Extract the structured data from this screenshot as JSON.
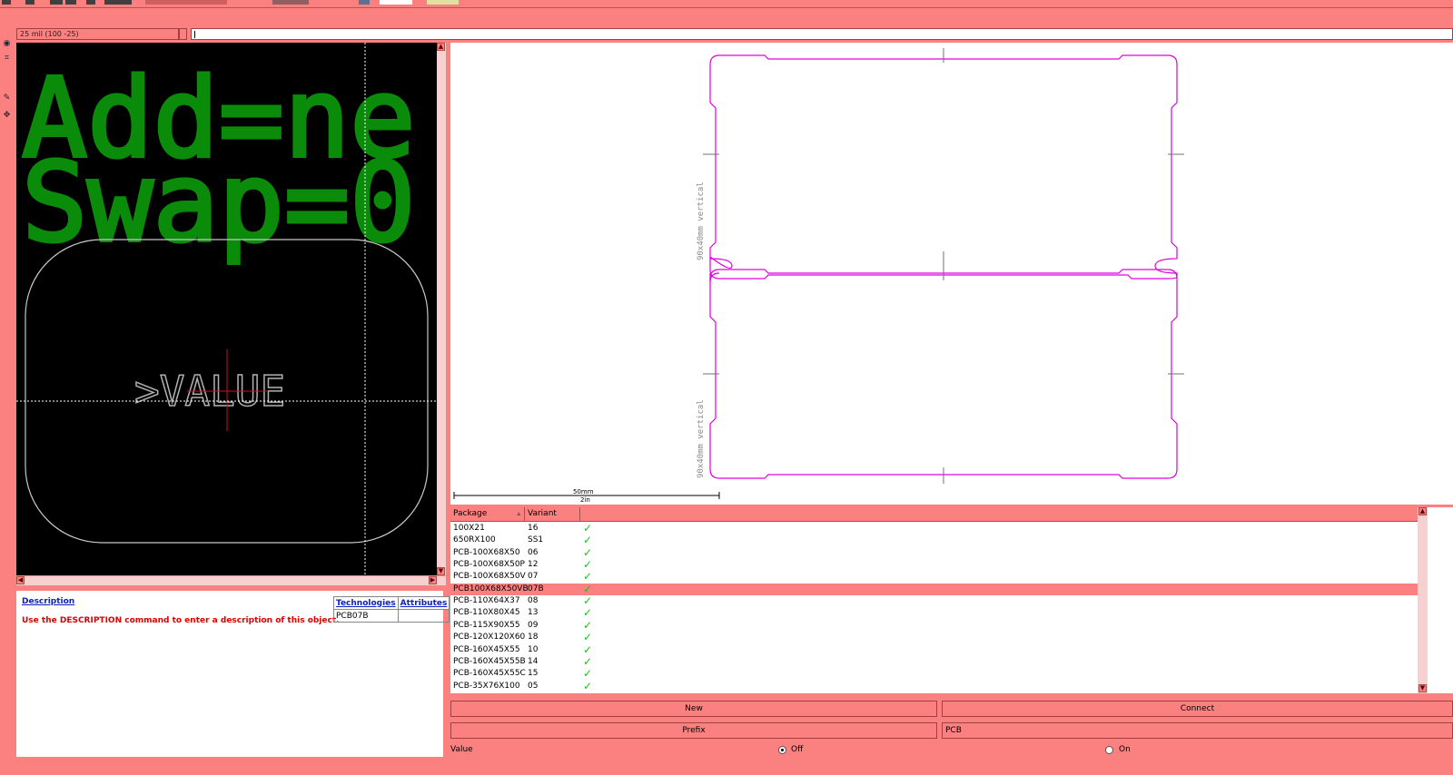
{
  "coordinate_readout": "25 mil (100 -25)",
  "editor": {
    "text_line1": "Add=ne",
    "text_line2": "Swap=0",
    "value_label": ">VALUE",
    "text_color": "#0a8c0a",
    "outline_color": "#c8c8c8"
  },
  "preview": {
    "side_label_top": "90x40mm vertical",
    "side_label_bottom": "90x40mm vertical",
    "scale_mm": "50mm",
    "scale_in": "2in",
    "outline_color": "#e000e0"
  },
  "description": {
    "link": "Description",
    "text": "Use the DESCRIPTION command to enter a description of this object.",
    "tech_header": "Technologies",
    "attr_header": "Attributes",
    "tech_value": "PCB07B",
    "attr_value": ""
  },
  "packages": {
    "col_package": "Package",
    "col_variant": "Variant",
    "check_icon": "check-icon",
    "rows": [
      {
        "package": "100X21",
        "variant": "16"
      },
      {
        "package": "650RX100",
        "variant": "SS1"
      },
      {
        "package": "PCB-100X68X50",
        "variant": "06"
      },
      {
        "package": "PCB-100X68X50P",
        "variant": "12"
      },
      {
        "package": "PCB-100X68X50V",
        "variant": "07"
      },
      {
        "package": "PCB100X68X50VB",
        "variant": "07B"
      },
      {
        "package": "PCB-110X64X37",
        "variant": "08"
      },
      {
        "package": "PCB-110X80X45",
        "variant": "13"
      },
      {
        "package": "PCB-115X90X55",
        "variant": "09"
      },
      {
        "package": "PCB-120X120X60",
        "variant": "18"
      },
      {
        "package": "PCB-160X45X55",
        "variant": "10"
      },
      {
        "package": "PCB-160X45X55B",
        "variant": "14"
      },
      {
        "package": "PCB-160X45X55C",
        "variant": "15"
      },
      {
        "package": "PCB-35X76X100",
        "variant": "05"
      }
    ],
    "selected_index": 5
  },
  "buttons": {
    "new": "New",
    "connect": "Connect",
    "prefix": "Prefix",
    "prefix_value": "PCB"
  },
  "value_row": {
    "label": "Value",
    "off": "Off",
    "on": "On",
    "selected": "Off"
  }
}
